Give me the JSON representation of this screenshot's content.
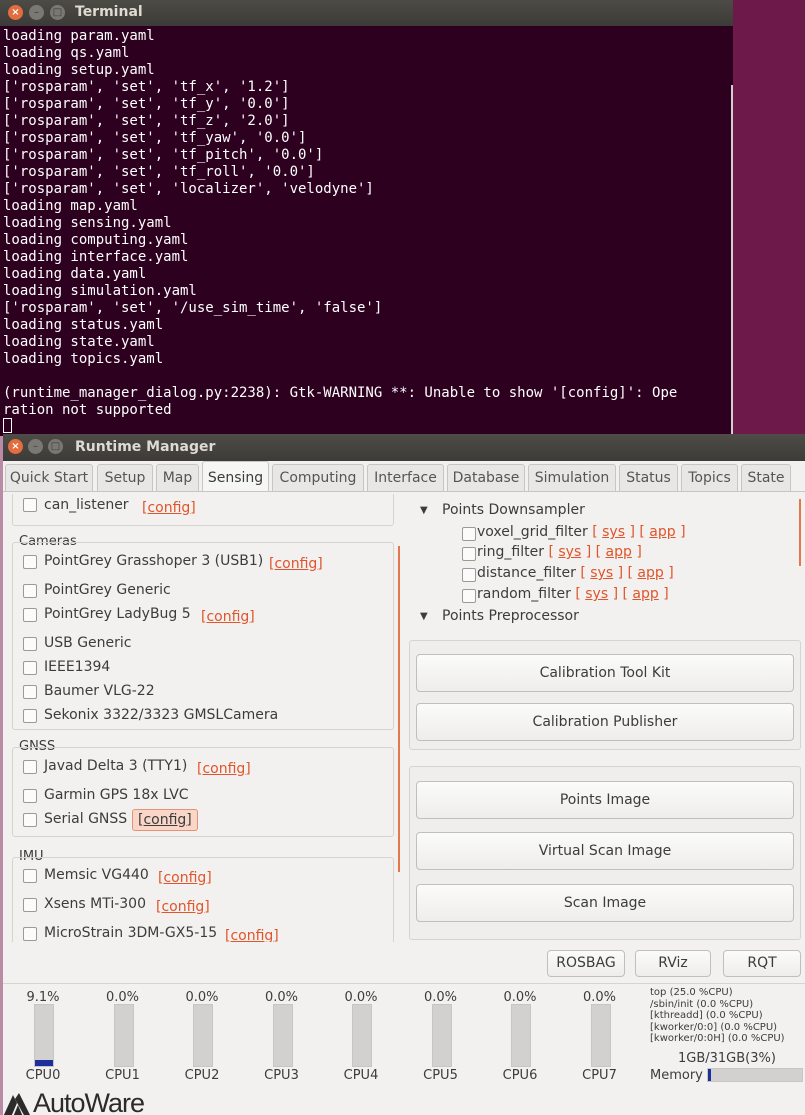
{
  "terminal": {
    "title": "Terminal",
    "lines": [
      "loading param.yaml",
      "loading qs.yaml",
      "loading setup.yaml",
      "['rosparam', 'set', 'tf_x', '1.2']",
      "['rosparam', 'set', 'tf_y', '0.0']",
      "['rosparam', 'set', 'tf_z', '2.0']",
      "['rosparam', 'set', 'tf_yaw', '0.0']",
      "['rosparam', 'set', 'tf_pitch', '0.0']",
      "['rosparam', 'set', 'tf_roll', '0.0']",
      "['rosparam', 'set', 'localizer', 'velodyne']",
      "loading map.yaml",
      "loading sensing.yaml",
      "loading computing.yaml",
      "loading interface.yaml",
      "loading data.yaml",
      "loading simulation.yaml",
      "['rosparam', 'set', '/use_sim_time', 'false']",
      "loading status.yaml",
      "loading state.yaml",
      "loading topics.yaml",
      "",
      "(runtime_manager_dialog.py:2238): Gtk-WARNING **: Unable to show '[config]': Ope",
      "ration not supported"
    ]
  },
  "window": {
    "title": "Runtime Manager",
    "tabs": [
      "Quick Start",
      "Setup",
      "Map",
      "Sensing",
      "Computing",
      "Interface",
      "Database",
      "Simulation",
      "Status",
      "Topics",
      "State"
    ],
    "active_tab": "Sensing"
  },
  "left": {
    "can_listener": {
      "label": "can_listener",
      "config": "[config]"
    },
    "cameras": {
      "title": "Cameras",
      "items": [
        {
          "label": "PointGrey Grasshoper 3 (USB1)",
          "config": "[config]"
        },
        {
          "label": "PointGrey Generic",
          "config": ""
        },
        {
          "label": "PointGrey LadyBug 5",
          "config": "[config]"
        },
        {
          "label": "USB Generic",
          "config": ""
        },
        {
          "label": "IEEE1394",
          "config": ""
        },
        {
          "label": "Baumer VLG-22",
          "config": ""
        },
        {
          "label": "Sekonix 3322/3323 GMSLCamera",
          "config": ""
        }
      ]
    },
    "gnss": {
      "title": "GNSS",
      "items": [
        {
          "label": "Javad Delta 3 (TTY1)",
          "config": "[config]"
        },
        {
          "label": "Garmin GPS 18x LVC",
          "config": ""
        },
        {
          "label": "Serial GNSS",
          "config": "[config]"
        }
      ]
    },
    "imu": {
      "title": "IMU",
      "items": [
        {
          "label": "Memsic VG440",
          "config": "[config]"
        },
        {
          "label": "Xsens MTi-300",
          "config": "[config]"
        },
        {
          "label": "MicroStrain 3DM-GX5-15",
          "config": "[config]"
        }
      ]
    }
  },
  "right": {
    "downsampler": {
      "title": "Points Downsampler",
      "items": [
        {
          "label": "voxel_grid_filter"
        },
        {
          "label": "ring_filter"
        },
        {
          "label": "distance_filter"
        },
        {
          "label": "random_filter"
        }
      ],
      "sys": "sys",
      "app": "app"
    },
    "preprocessor": {
      "title": "Points Preprocessor"
    },
    "buttons": {
      "calib_kit": "Calibration Tool Kit",
      "calib_pub": "Calibration Publisher",
      "points_image": "Points Image",
      "virtual_scan": "Virtual Scan Image",
      "scan_image": "Scan Image"
    }
  },
  "bottom_buttons": {
    "rosbag": "ROSBAG",
    "rviz": "RViz",
    "rqt": "RQT"
  },
  "cpus": [
    {
      "name": "CPU0",
      "pct": "9.1%",
      "level": 0.091
    },
    {
      "name": "CPU1",
      "pct": "0.0%",
      "level": 0
    },
    {
      "name": "CPU2",
      "pct": "0.0%",
      "level": 0
    },
    {
      "name": "CPU3",
      "pct": "0.0%",
      "level": 0
    },
    {
      "name": "CPU4",
      "pct": "0.0%",
      "level": 0
    },
    {
      "name": "CPU5",
      "pct": "0.0%",
      "level": 0
    },
    {
      "name": "CPU6",
      "pct": "0.0%",
      "level": 0
    },
    {
      "name": "CPU7",
      "pct": "0.0%",
      "level": 0
    }
  ],
  "top_procs": [
    "top (25.0 %CPU)",
    "/sbin/init (0.0 %CPU)",
    "[kthreadd] (0.0 %CPU)",
    "[kworker/0:0] (0.0 %CPU)",
    "[kworker/0:0H] (0.0 %CPU)"
  ],
  "memory": {
    "label": "Memory",
    "value": "1GB/31GB(3%)",
    "level": 0.03
  },
  "logo": {
    "text": "AutoWare"
  },
  "colors": {
    "accent": "#e0552b",
    "terminal_bg": "#2c001e",
    "bar_fill": "#1d2f9c"
  }
}
